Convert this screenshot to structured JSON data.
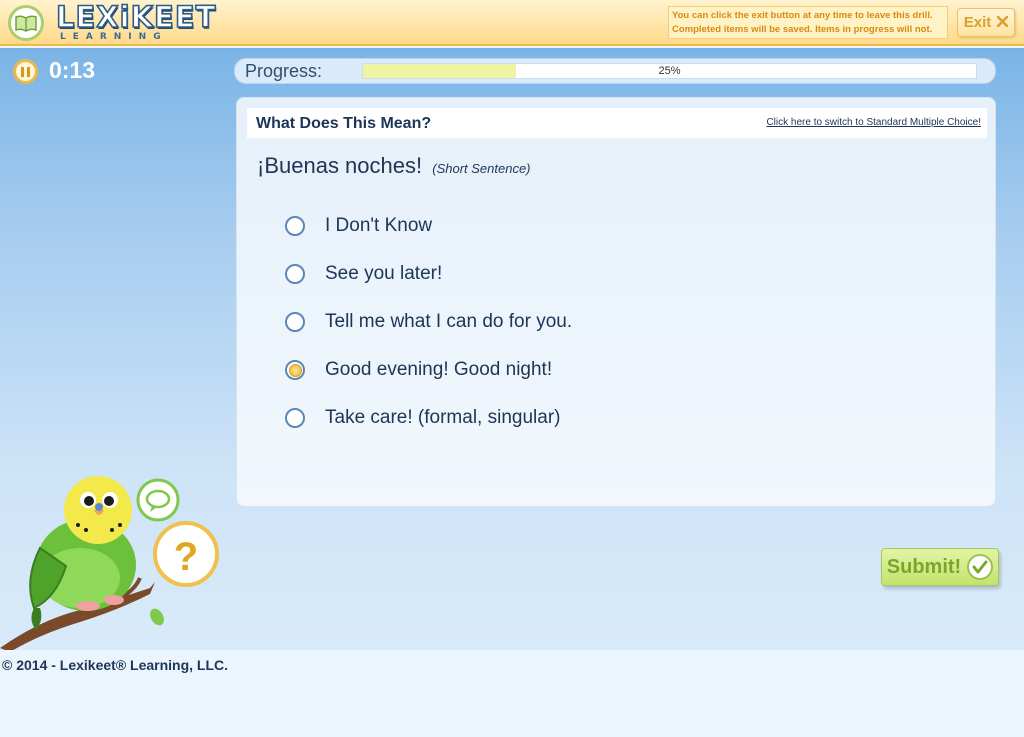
{
  "app": {
    "logo_text": "LEXiKEET",
    "logo_sub": "LEARNING"
  },
  "header": {
    "exit_note": "You can click the exit button at any time to leave this drill. Completed items will be saved. Items in progress will not.",
    "exit_label": "Exit"
  },
  "timer": {
    "value": "0:13"
  },
  "progress": {
    "label": "Progress:",
    "percent_text": "25%",
    "fraction": 0.25
  },
  "question": {
    "header_title": "What Does This Mean?",
    "switch_link": "Click here to switch to Standard Multiple Choice!",
    "prompt": "¡Buenas noches!",
    "prompt_type": "(Short Sentence)",
    "options": [
      {
        "label": "I Don't Know",
        "selected": false
      },
      {
        "label": "See you later!",
        "selected": false
      },
      {
        "label": "Tell me what I can do for you.",
        "selected": false
      },
      {
        "label": "Good evening! Good night!",
        "selected": true
      },
      {
        "label": "Take care! (formal, singular)",
        "selected": false
      }
    ]
  },
  "submit": {
    "label": "Submit!"
  },
  "footer": {
    "copyright": "© 2014 - Lexikeet® Learning, LLC."
  },
  "colors": {
    "header_bg": "#ffd98a",
    "accent_blue": "#1d3557",
    "submit_green": "#c3e26e",
    "progress_fill": "#eef4a3"
  }
}
